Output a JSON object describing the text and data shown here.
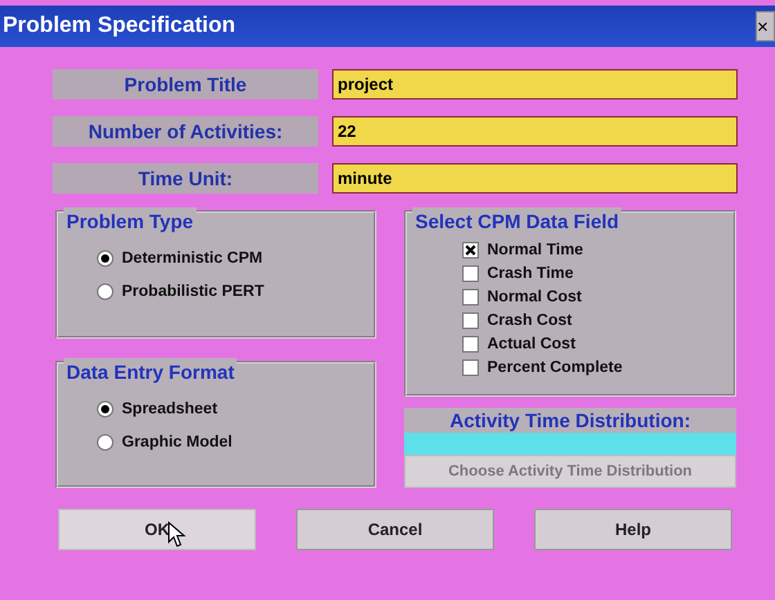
{
  "window": {
    "title": "Problem Specification",
    "close": "×"
  },
  "fields": [
    {
      "label": "Problem Title",
      "value": "project"
    },
    {
      "label": "Number of Activities:",
      "value": "22"
    },
    {
      "label": "Time Unit:",
      "value": "minute"
    }
  ],
  "problem_type": {
    "title": "Problem Type",
    "options": [
      {
        "label": "Deterministic CPM",
        "selected": true
      },
      {
        "label": "Probabilistic PERT",
        "selected": false
      }
    ]
  },
  "data_entry_format": {
    "title": "Data Entry Format",
    "options": [
      {
        "label": "Spreadsheet",
        "selected": true
      },
      {
        "label": "Graphic Model",
        "selected": false
      }
    ]
  },
  "cpm_data_field": {
    "title": "Select CPM Data Field",
    "options": [
      {
        "label": "Normal Time",
        "checked": true
      },
      {
        "label": "Crash Time",
        "checked": false
      },
      {
        "label": "Normal Cost",
        "checked": false
      },
      {
        "label": "Crash Cost",
        "checked": false
      },
      {
        "label": "Actual Cost",
        "checked": false
      },
      {
        "label": "Percent Complete",
        "checked": false
      }
    ]
  },
  "activity_time_distribution": {
    "title": "Activity Time Distribution:",
    "button": "Choose Activity Time Distribution",
    "disabled": true
  },
  "buttons": [
    {
      "label": "OK",
      "focused": true
    },
    {
      "label": "Cancel",
      "focused": false
    },
    {
      "label": "Help",
      "focused": false
    }
  ]
}
